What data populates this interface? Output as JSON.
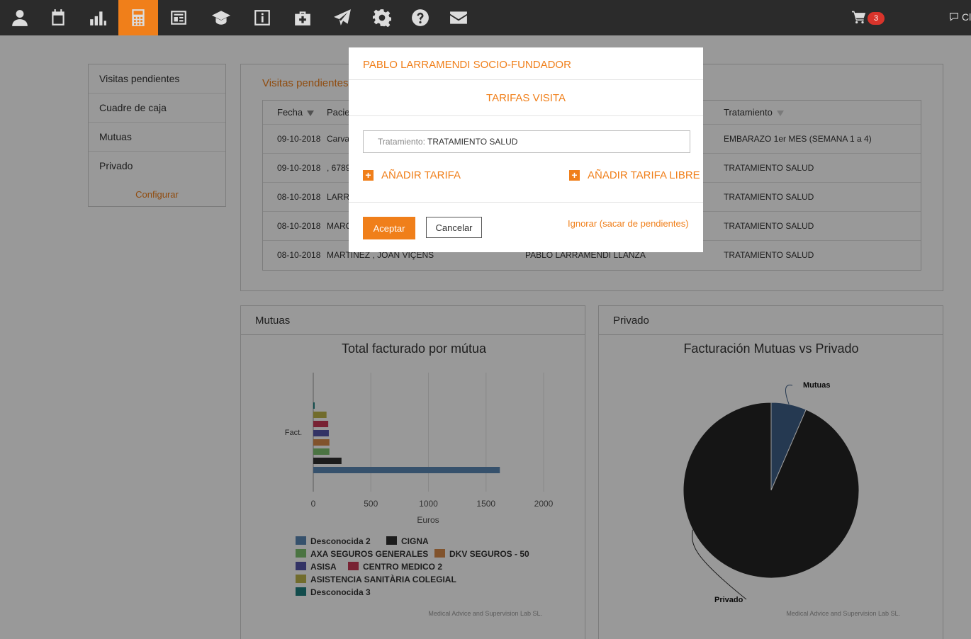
{
  "nav": {
    "cart_count": "3",
    "chat_label": "Cl"
  },
  "colors": {
    "accent": "#f07f1a",
    "topbar": "#2b2b2b",
    "badge": "#d9342b"
  },
  "left_menu": {
    "items": [
      "Visitas pendientes",
      "Cuadre de caja",
      "Mutuas",
      "Privado"
    ],
    "configure": "Configurar"
  },
  "visits": {
    "title": "Visitas pendientes",
    "columns": {
      "fecha": "Fecha",
      "paciente": "Pacien",
      "tratamiento": "Tratamiento"
    },
    "rows": [
      {
        "fecha": "09-10-2018",
        "paciente": "Carva",
        "doctor": "",
        "tratamiento": "EMBARAZO 1er MES (SEMANA 1 a 4)"
      },
      {
        "fecha": "09-10-2018",
        "paciente": ", 6789",
        "doctor": "",
        "tratamiento": "TRATAMIENTO SALUD"
      },
      {
        "fecha": "08-10-2018",
        "paciente": "LARRA",
        "doctor": "",
        "tratamiento": "TRATAMIENTO SALUD"
      },
      {
        "fecha": "08-10-2018",
        "paciente": "MARQ",
        "doctor": "",
        "tratamiento": "TRATAMIENTO SALUD"
      },
      {
        "fecha": "08-10-2018",
        "paciente": "MARTINEZ , JOAN VIÇENS",
        "doctor": "PABLO LARRAMENDI LLANZA",
        "tratamiento": "TRATAMIENTO SALUD"
      }
    ]
  },
  "mutuas_panel": {
    "heading": "Mutuas"
  },
  "privado_panel": {
    "heading": "Privado"
  },
  "chart_data": [
    {
      "type": "bar",
      "orientation": "horizontal",
      "title": "Total facturado por mútua",
      "xlabel": "Euros",
      "ylabel": "Fact.",
      "xlim": [
        0,
        2000
      ],
      "xticks": [
        "0",
        "500",
        "1000",
        "1500",
        "2000"
      ],
      "grid": true,
      "legend_position": "bottom",
      "credit": "Medical Advice and Supervision Lab SL.",
      "series": [
        {
          "name": "Desconocida 2",
          "value": 1620,
          "color": "#5b87b5"
        },
        {
          "name": "CIGNA",
          "value": 245,
          "color": "#2f2f2f"
        },
        {
          "name": "AXA SEGUROS GENERALES",
          "value": 140,
          "color": "#7ec16f"
        },
        {
          "name": "DKV SEGUROS - 50",
          "value": 140,
          "color": "#d88a4a"
        },
        {
          "name": "ASISA",
          "value": 135,
          "color": "#5656a8"
        },
        {
          "name": "CENTRO MEDICO 2",
          "value": 130,
          "color": "#c83a55"
        },
        {
          "name": "ASISTENCIA SANITÀRIA COLEGIAL",
          "value": 115,
          "color": "#bcb54a"
        },
        {
          "name": "Desconocida 3",
          "value": 12,
          "color": "#1f7f7f"
        }
      ]
    },
    {
      "type": "pie",
      "title": "Facturación Mutuas vs Privado",
      "credit": "Medical Advice and Supervision Lab SL.",
      "slices": [
        {
          "name": "Mutuas",
          "value": 6.5,
          "color": "#3e5f88"
        },
        {
          "name": "Privado",
          "value": 93.5,
          "color": "#242424"
        }
      ]
    }
  ],
  "modal": {
    "title": "PABLO LARRAMENDI SOCIO-FUNDADOR",
    "subtitle": "TARIFAS VISITA",
    "field_label": "Tratamiento:",
    "field_value": "TRATAMIENTO SALUD",
    "add_tarifa": "AÑADIR TARIFA",
    "add_tarifa_libre": "AÑADIR TARIFA LIBRE",
    "plus": "+",
    "accept": "Aceptar",
    "cancel": "Cancelar",
    "ignore": "Ignorar (sacar de pendientes)"
  }
}
